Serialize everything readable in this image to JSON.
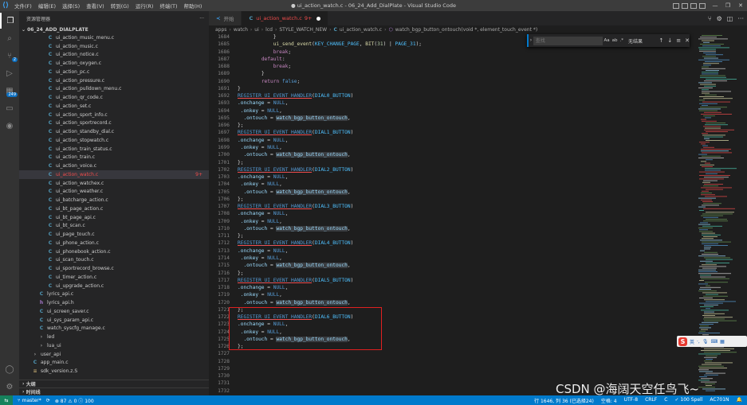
{
  "window": {
    "title": "● ui_action_watch.c - 06_24_Add_DialPlate - Visual Studio Code",
    "menus": [
      "文件(F)",
      "编辑(E)",
      "选择(S)",
      "查看(V)",
      "转到(G)",
      "运行(R)",
      "终端(T)",
      "帮助(H)"
    ],
    "controls": {
      "minimize": "—",
      "maximize": "❐",
      "close": "✕"
    }
  },
  "activity_bar": {
    "scm_badge": "2",
    "extensions_badge": "249"
  },
  "sidebar": {
    "title": "资源管理器",
    "more": "···",
    "root": "06_24_ADD_DIALPLATE",
    "items": [
      {
        "name": "ui_action_music_menu.c",
        "type": "c",
        "indent": 1
      },
      {
        "name": "ui_action_music.c",
        "type": "c",
        "indent": 1
      },
      {
        "name": "ui_action_notice.c",
        "type": "c",
        "indent": 1
      },
      {
        "name": "ui_action_oxygen.c",
        "type": "c",
        "indent": 1
      },
      {
        "name": "ui_action_pc.c",
        "type": "c",
        "indent": 1
      },
      {
        "name": "ui_action_pressure.c",
        "type": "c",
        "indent": 1
      },
      {
        "name": "ui_action_pulldown_menu.c",
        "type": "c",
        "indent": 1
      },
      {
        "name": "ui_action_qr_code.c",
        "type": "c",
        "indent": 1
      },
      {
        "name": "ui_action_set.c",
        "type": "c",
        "indent": 1
      },
      {
        "name": "ui_action_sport_info.c",
        "type": "c",
        "indent": 1
      },
      {
        "name": "ui_action_sportrecord.c",
        "type": "c",
        "indent": 1
      },
      {
        "name": "ui_action_standby_dial.c",
        "type": "c",
        "indent": 1
      },
      {
        "name": "ui_action_stopwatch.c",
        "type": "c",
        "indent": 1
      },
      {
        "name": "ui_action_train_status.c",
        "type": "c",
        "indent": 1
      },
      {
        "name": "ui_action_train.c",
        "type": "c",
        "indent": 1
      },
      {
        "name": "ui_action_voice.c",
        "type": "c",
        "indent": 1
      },
      {
        "name": "ui_action_watch.c",
        "type": "c",
        "indent": 1,
        "state": "error",
        "badge": "9+"
      },
      {
        "name": "ui_action_watchex.c",
        "type": "c",
        "indent": 1
      },
      {
        "name": "ui_action_weather.c",
        "type": "c",
        "indent": 1
      },
      {
        "name": "ui_batcharge_action.c",
        "type": "c",
        "indent": 1
      },
      {
        "name": "ui_bt_page_action.c",
        "type": "c",
        "indent": 1
      },
      {
        "name": "ui_bt_page_api.c",
        "type": "c",
        "indent": 1
      },
      {
        "name": "ui_bt_scan.c",
        "type": "c",
        "indent": 1
      },
      {
        "name": "ui_page_touch.c",
        "type": "c",
        "indent": 1
      },
      {
        "name": "ui_phone_action.c",
        "type": "c",
        "indent": 1
      },
      {
        "name": "ui_phonebook_action.c",
        "type": "c",
        "indent": 1
      },
      {
        "name": "ui_scan_touch.c",
        "type": "c",
        "indent": 1
      },
      {
        "name": "ui_sportrecord_browse.c",
        "type": "c",
        "indent": 1
      },
      {
        "name": "ui_timer_action.c",
        "type": "c",
        "indent": 1
      },
      {
        "name": "ui_upgrade_action.c",
        "type": "c",
        "indent": 1
      },
      {
        "name": "lyrics_api.c",
        "type": "c",
        "indent": 0
      },
      {
        "name": "lyrics_api.h",
        "type": "h",
        "indent": 0
      },
      {
        "name": "ui_screen_saver.c",
        "type": "c",
        "indent": 0
      },
      {
        "name": "ui_sys_param_api.c",
        "type": "c",
        "indent": 0
      },
      {
        "name": "watch_syscfg_manage.c",
        "type": "c",
        "indent": 0
      },
      {
        "name": "led",
        "type": "folder",
        "indent": 0
      },
      {
        "name": "lua_ui",
        "type": "folder",
        "indent": 0
      },
      {
        "name": "user_api",
        "type": "folder",
        "indent": -1
      },
      {
        "name": "app_main.c",
        "type": "c",
        "indent": -1
      },
      {
        "name": "sdk_version.z.S",
        "type": "s",
        "indent": -1
      }
    ],
    "sections": [
      "大纲",
      "时间线"
    ]
  },
  "tabs": [
    {
      "label": "开始",
      "icon": "vscode-icon",
      "active": false
    },
    {
      "label": "ui_action_watch.c",
      "icon": "c-file-icon",
      "active": true,
      "count": "9+",
      "dirty": true
    }
  ],
  "breadcrumbs": [
    "apps",
    "watch",
    "ui",
    "lcd",
    "STYLE_WATCH_NEW",
    "ui_action_watch.c",
    "watch_bgp_button_ontouch(void *, element_touch_event *)"
  ],
  "find": {
    "placeholder": "查找",
    "options": [
      "Aa",
      "ab",
      ".*"
    ],
    "result": "无结果",
    "prev": "↑",
    "next": "↓",
    "menu": "≡",
    "close": "✕"
  },
  "code_lines": [
    {
      "no": "1684",
      "segs": [
        [
          "            ",
          "pun"
        ],
        [
          "}",
          "pun"
        ]
      ]
    },
    {
      "no": "1685",
      "segs": [
        [
          "            ",
          "pun"
        ],
        [
          "ui_send_event",
          "fn"
        ],
        [
          "(",
          "pun"
        ],
        [
          "KEY_CHANGE_PAGE",
          "cst"
        ],
        [
          ", ",
          "pun"
        ],
        [
          "BIT",
          "fn"
        ],
        [
          "(",
          "pun"
        ],
        [
          "31",
          "num"
        ],
        [
          ") | ",
          "pun"
        ],
        [
          "PAGE_31",
          "cst"
        ],
        [
          ");",
          "pun"
        ]
      ]
    },
    {
      "no": "1686",
      "segs": [
        [
          "            ",
          "pun"
        ],
        [
          "break",
          "kw2"
        ],
        [
          ";",
          "pun"
        ]
      ]
    },
    {
      "no": "1687",
      "segs": [
        [
          "        ",
          "pun"
        ],
        [
          "default",
          "kw2"
        ],
        [
          ":",
          "pun"
        ]
      ]
    },
    {
      "no": "1688",
      "segs": [
        [
          "            ",
          "pun"
        ],
        [
          "break",
          "kw2"
        ],
        [
          ";",
          "pun"
        ]
      ]
    },
    {
      "no": "1689",
      "segs": [
        [
          "        ",
          "pun"
        ],
        [
          "}",
          "pun"
        ]
      ]
    },
    {
      "no": "1690",
      "segs": [
        [
          "        ",
          "pun"
        ],
        [
          "return",
          "kw2"
        ],
        [
          " ",
          "pun"
        ],
        [
          "false",
          "kw"
        ],
        [
          ";",
          "pun"
        ]
      ]
    },
    {
      "no": "1691",
      "segs": [
        [
          "}",
          "pun"
        ]
      ]
    },
    {
      "no": "1692",
      "segs": [
        [
          "REGISTER_UI_EVENT_HANDLER",
          "mac ul"
        ],
        [
          "(",
          "pun"
        ],
        [
          "DIAL0_BUTTON",
          "cst"
        ],
        [
          ")",
          "pun"
        ]
      ]
    },
    {
      "no": "1693",
      "segs": [
        [
          ".onchange",
          "mem"
        ],
        [
          " = ",
          "pun"
        ],
        [
          "NULL",
          "kw"
        ],
        [
          ",",
          "pun"
        ]
      ]
    },
    {
      "no": "1694",
      "segs": [
        [
          " .onkey",
          "mem"
        ],
        [
          " = ",
          "pun"
        ],
        [
          "NULL",
          "kw"
        ],
        [
          ",",
          "pun"
        ]
      ]
    },
    {
      "no": "1695",
      "segs": [
        [
          "  .ontouch",
          "mem"
        ],
        [
          " = ",
          "pun"
        ],
        [
          "watch_bgp_button_ontouch",
          "hl"
        ],
        [
          ",",
          "pun"
        ]
      ]
    },
    {
      "no": "1696",
      "segs": [
        [
          "};",
          "pun"
        ]
      ]
    },
    {
      "no": "1697",
      "segs": [
        [
          "REGISTER_UI_EVENT_HANDLER",
          "mac ul"
        ],
        [
          "(",
          "pun"
        ],
        [
          "DIAL1_BUTTON",
          "cst"
        ],
        [
          ")",
          "pun"
        ]
      ]
    },
    {
      "no": "1698",
      "segs": [
        [
          ".onchange",
          "mem"
        ],
        [
          " = ",
          "pun"
        ],
        [
          "NULL",
          "kw"
        ],
        [
          ",",
          "pun"
        ]
      ]
    },
    {
      "no": "1699",
      "segs": [
        [
          " .onkey",
          "mem"
        ],
        [
          " = ",
          "pun"
        ],
        [
          "NULL",
          "kw"
        ],
        [
          ",",
          "pun"
        ]
      ]
    },
    {
      "no": "1700",
      "segs": [
        [
          "  .ontouch",
          "mem"
        ],
        [
          " = ",
          "pun"
        ],
        [
          "watch_bgp_button_ontouch",
          "hl"
        ],
        [
          ",",
          "pun"
        ]
      ]
    },
    {
      "no": "1701",
      "segs": [
        [
          "};",
          "pun"
        ]
      ]
    },
    {
      "no": "1702",
      "segs": [
        [
          "REGISTER_UI_EVENT_HANDLER",
          "mac ul"
        ],
        [
          "(",
          "pun"
        ],
        [
          "DIAL2_BUTTON",
          "cst"
        ],
        [
          ")",
          "pun"
        ]
      ]
    },
    {
      "no": "1703",
      "segs": [
        [
          ".onchange",
          "mem"
        ],
        [
          " = ",
          "pun"
        ],
        [
          "NULL",
          "kw"
        ],
        [
          ",",
          "pun"
        ]
      ]
    },
    {
      "no": "1704",
      "segs": [
        [
          " .onkey",
          "mem"
        ],
        [
          " = ",
          "pun"
        ],
        [
          "NULL",
          "kw"
        ],
        [
          ",",
          "pun"
        ]
      ]
    },
    {
      "no": "1705",
      "segs": [
        [
          "  .ontouch",
          "mem"
        ],
        [
          " = ",
          "pun"
        ],
        [
          "watch_bgp_button_ontouch",
          "hl"
        ],
        [
          ",",
          "pun"
        ]
      ]
    },
    {
      "no": "1706",
      "segs": [
        [
          "};",
          "pun"
        ]
      ]
    },
    {
      "no": "1707",
      "segs": [
        [
          "REGISTER_UI_EVENT_HANDLER",
          "mac ul"
        ],
        [
          "(",
          "pun"
        ],
        [
          "DIAL3_BUTTON",
          "cst"
        ],
        [
          ")",
          "pun"
        ]
      ]
    },
    {
      "no": "1708",
      "segs": [
        [
          ".onchange",
          "mem"
        ],
        [
          " = ",
          "pun"
        ],
        [
          "NULL",
          "kw"
        ],
        [
          ",",
          "pun"
        ]
      ]
    },
    {
      "no": "1709",
      "segs": [
        [
          " .onkey",
          "mem"
        ],
        [
          " = ",
          "pun"
        ],
        [
          "NULL",
          "kw"
        ],
        [
          ",",
          "pun"
        ]
      ]
    },
    {
      "no": "1710",
      "segs": [
        [
          "  .ontouch",
          "mem"
        ],
        [
          " = ",
          "pun"
        ],
        [
          "watch_bgp_button_ontouch",
          "hl"
        ],
        [
          ",",
          "pun"
        ]
      ]
    },
    {
      "no": "1711",
      "segs": [
        [
          "};",
          "pun"
        ]
      ]
    },
    {
      "no": "1712",
      "segs": [
        [
          "REGISTER_UI_EVENT_HANDLER",
          "mac ul"
        ],
        [
          "(",
          "pun"
        ],
        [
          "DIAL4_BUTTON",
          "cst"
        ],
        [
          ")",
          "pun"
        ]
      ]
    },
    {
      "no": "1713",
      "segs": [
        [
          ".onchange",
          "mem"
        ],
        [
          " = ",
          "pun"
        ],
        [
          "NULL",
          "kw"
        ],
        [
          ",",
          "pun"
        ]
      ]
    },
    {
      "no": "1714",
      "segs": [
        [
          " .onkey",
          "mem"
        ],
        [
          " = ",
          "pun"
        ],
        [
          "NULL",
          "kw"
        ],
        [
          ",",
          "pun"
        ]
      ]
    },
    {
      "no": "1715",
      "segs": [
        [
          "  .ontouch",
          "mem"
        ],
        [
          " = ",
          "pun"
        ],
        [
          "watch_bgp_button_ontouch",
          "hl"
        ],
        [
          ",",
          "pun"
        ]
      ]
    },
    {
      "no": "1716",
      "segs": [
        [
          "};",
          "pun"
        ]
      ]
    },
    {
      "no": "1717",
      "segs": [
        [
          "REGISTER_UI_EVENT_HANDLER",
          "mac ul"
        ],
        [
          "(",
          "pun"
        ],
        [
          "DIAL5_BUTTON",
          "cst"
        ],
        [
          ")",
          "pun"
        ]
      ]
    },
    {
      "no": "1718",
      "segs": [
        [
          ".onchange",
          "mem"
        ],
        [
          " = ",
          "pun"
        ],
        [
          "NULL",
          "kw"
        ],
        [
          ",",
          "pun"
        ]
      ]
    },
    {
      "no": "1719",
      "segs": [
        [
          " .onkey",
          "mem"
        ],
        [
          " = ",
          "pun"
        ],
        [
          "NULL",
          "kw"
        ],
        [
          ",",
          "pun"
        ]
      ]
    },
    {
      "no": "1720",
      "segs": [
        [
          "  .ontouch",
          "mem"
        ],
        [
          " = ",
          "pun"
        ],
        [
          "watch_bgp_button_ontouch",
          "hl"
        ],
        [
          ",",
          "pun"
        ]
      ]
    },
    {
      "no": "1721",
      "segs": [
        [
          "};",
          "pun"
        ]
      ]
    },
    {
      "no": "1722",
      "segs": [
        [
          "REGISTER_UI_EVENT_HANDLER",
          "mac ul"
        ],
        [
          "(",
          "pun"
        ],
        [
          "DIAL6_BUTTON",
          "cst"
        ],
        [
          ")",
          "pun"
        ]
      ]
    },
    {
      "no": "1723",
      "segs": [
        [
          ".onchange",
          "mem"
        ],
        [
          " = ",
          "pun"
        ],
        [
          "NULL",
          "kw"
        ],
        [
          ",",
          "pun"
        ]
      ]
    },
    {
      "no": "1724",
      "segs": [
        [
          " .onkey",
          "mem"
        ],
        [
          " = ",
          "pun"
        ],
        [
          "NULL",
          "kw"
        ],
        [
          ",",
          "pun"
        ]
      ]
    },
    {
      "no": "1725",
      "segs": [
        [
          "  .ontouch",
          "mem"
        ],
        [
          " = ",
          "pun"
        ],
        [
          "watch_bgp_button_ontouch",
          "hl"
        ],
        [
          ",",
          "pun"
        ]
      ]
    },
    {
      "no": "1726",
      "segs": [
        [
          "};",
          "pun"
        ]
      ]
    },
    {
      "no": "1727",
      "segs": []
    },
    {
      "no": "1728",
      "segs": []
    },
    {
      "no": "1729",
      "segs": []
    },
    {
      "no": "1730",
      "segs": []
    },
    {
      "no": "1731",
      "segs": []
    },
    {
      "no": "1732",
      "segs": []
    }
  ],
  "ime": {
    "mode": "英",
    "symbols": "·,",
    "icons": [
      "mic-icon",
      "keyboard-icon",
      "grid-icon"
    ]
  },
  "status_bar": {
    "branch": "master*",
    "sync": "⟳",
    "problems": "⊗ 87  ⚠ 0  ⓘ 100",
    "position": "行 1646, 列 36 (已选择24)",
    "spaces": "空格: 4",
    "encoding": "UTF-8",
    "eol": "CRLF",
    "language": "C",
    "spell": "✓ 100 Spell",
    "target": "AC701N"
  },
  "watermark": "CSDN @海阔天空任鸟飞~",
  "colors": {
    "accent": "#007acc",
    "error": "#f14c4c",
    "annotation_box": "#e02020"
  }
}
